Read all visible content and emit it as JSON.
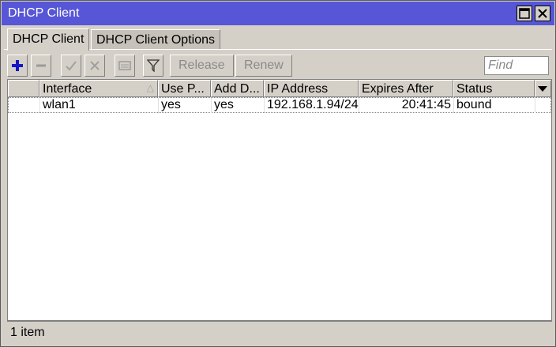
{
  "window": {
    "title": "DHCP Client"
  },
  "tabs": [
    {
      "label": "DHCP Client",
      "active": true
    },
    {
      "label": "DHCP Client Options",
      "active": false
    }
  ],
  "toolbar": {
    "release_label": "Release",
    "renew_label": "Renew",
    "find_placeholder": "Find",
    "icons": [
      "add-icon",
      "remove-icon",
      "enable-icon",
      "disable-icon",
      "comment-icon",
      "filter-icon"
    ]
  },
  "table": {
    "columns": [
      "Interface",
      "Use P...",
      "Add D...",
      "IP Address",
      "Expires After",
      "Status"
    ],
    "rows": [
      {
        "interface": "wlan1",
        "use_peer": "yes",
        "add_default": "yes",
        "ip": "192.168.1.94/24",
        "expires": "20:41:45",
        "status": "bound"
      }
    ]
  },
  "status": {
    "count_text": "1 item"
  },
  "colors": {
    "titlebar": "#5656d6",
    "add_icon": "#1515c8"
  }
}
